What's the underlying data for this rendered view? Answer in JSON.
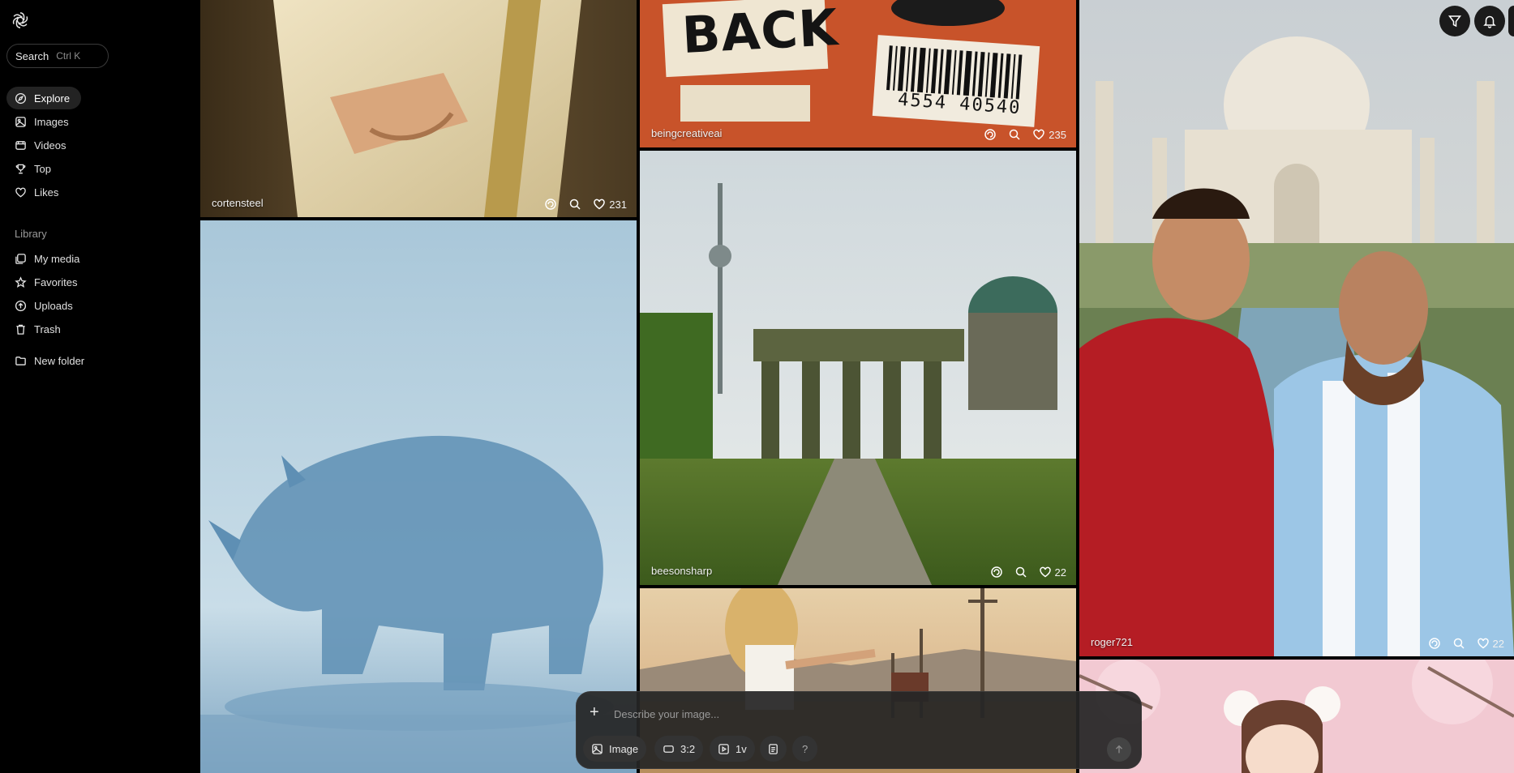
{
  "sidebar": {
    "search": {
      "label": "Search",
      "shortcut": "Ctrl K"
    },
    "nav": [
      {
        "label": "Explore",
        "icon": "compass-icon"
      },
      {
        "label": "Images",
        "icon": "image-icon"
      },
      {
        "label": "Videos",
        "icon": "video-icon"
      },
      {
        "label": "Top",
        "icon": "trophy-icon"
      },
      {
        "label": "Likes",
        "icon": "heart-icon"
      }
    ],
    "library_label": "Library",
    "library": [
      {
        "label": "My media",
        "icon": "media-icon"
      },
      {
        "label": "Favorites",
        "icon": "star-icon"
      },
      {
        "label": "Uploads",
        "icon": "upload-icon"
      },
      {
        "label": "Trash",
        "icon": "trash-icon"
      }
    ],
    "new_folder": "New folder"
  },
  "gallery": {
    "tiles": [
      {
        "user": "cortensteel",
        "likes": "231"
      },
      {
        "user": "beingcreativeai",
        "likes": "235"
      },
      {
        "user": "beesonsharp",
        "likes": "22"
      },
      {
        "user": "roger721",
        "likes": "22"
      }
    ],
    "poster_text": "BACK",
    "barcode_text": "4554 40540"
  },
  "prompt": {
    "placeholder": "Describe your image...",
    "mode": "Image",
    "aspect": "3:2",
    "variations": "1v",
    "help": "?"
  },
  "colors": {
    "accent": "#ffffff",
    "bg": "#000000",
    "panel": "#262626"
  }
}
